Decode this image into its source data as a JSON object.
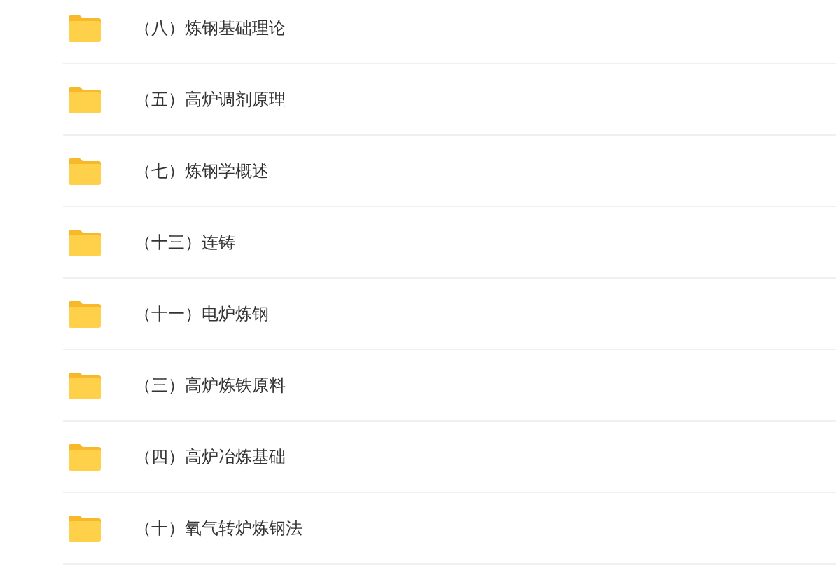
{
  "folders": [
    {
      "name": "（八）炼钢基础理论"
    },
    {
      "name": "（五）高炉调剂原理"
    },
    {
      "name": "（七）炼钢学概述"
    },
    {
      "name": "（十三）连铸"
    },
    {
      "name": "（十一）电炉炼钢"
    },
    {
      "name": "（三）高炉炼铁原料"
    },
    {
      "name": "（四）高炉冶炼基础"
    },
    {
      "name": "（十）氧气转炉炼钢法"
    }
  ]
}
